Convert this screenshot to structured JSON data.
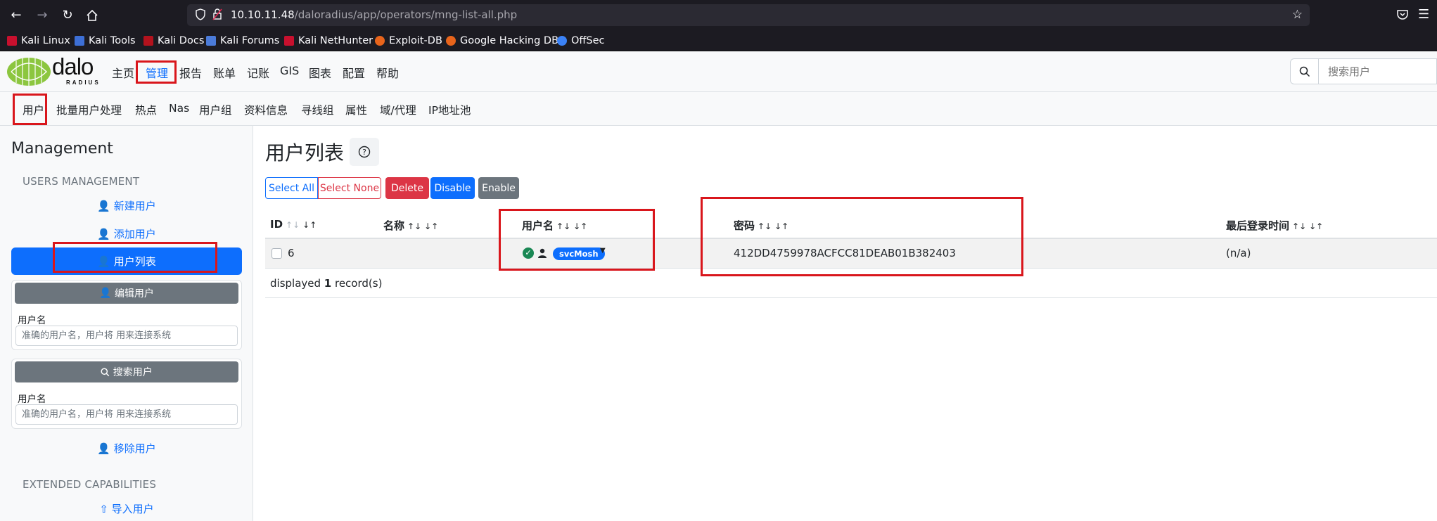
{
  "browser": {
    "url_host": "10.10.11.48",
    "url_path": "/daloradius/app/operators/mng-list-all.php",
    "bookmarks": [
      "Kali Linux",
      "Kali Tools",
      "Kali Docs",
      "Kali Forums",
      "Kali NetHunter",
      "Exploit-DB",
      "Google Hacking DB",
      "OffSec"
    ]
  },
  "logo": {
    "main": "dalo",
    "sub": "RADIUS"
  },
  "topnav": [
    "主页",
    "管理",
    "报告",
    "账单",
    "记账",
    "GIS",
    "图表",
    "配置",
    "帮助"
  ],
  "search": {
    "placeholder": "搜索用户"
  },
  "subnav": [
    "用户",
    "批量用户处理",
    "热点",
    "Nas",
    "用户组",
    "资料信息",
    "寻线组",
    "属性",
    "域/代理",
    "IP地址池"
  ],
  "sidebar": {
    "title": "Management",
    "section_users": "USERS MANAGEMENT",
    "new_user": "新建用户",
    "add_user": "添加用户",
    "list_users": "用户列表",
    "edit_user": "编辑用户",
    "username_label": "用户名",
    "username_placeholder": "准确的用户名，用户将 用来连接系统",
    "search_user": "搜索用户",
    "remove_user": "移除用户",
    "section_ext": "EXTENDED CAPABILITIES",
    "import_users": "导入用户"
  },
  "main": {
    "title": "用户列表",
    "buttons": {
      "select_all": "Select All",
      "select_none": "Select None",
      "delete": "Delete",
      "disable": "Disable",
      "enable": "Enable"
    },
    "columns": {
      "id": "ID",
      "name": "名称",
      "username": "用户名",
      "password": "密码",
      "last_login": "最后登录时间"
    },
    "rows": [
      {
        "id": "6",
        "name": "",
        "username": "svcMosh",
        "password": "412DD4759978ACFCC81DEAB01B382403",
        "last_login": "(n/a)"
      }
    ],
    "footer_prefix": "displayed ",
    "footer_count": "1",
    "footer_suffix": " record(s)"
  }
}
